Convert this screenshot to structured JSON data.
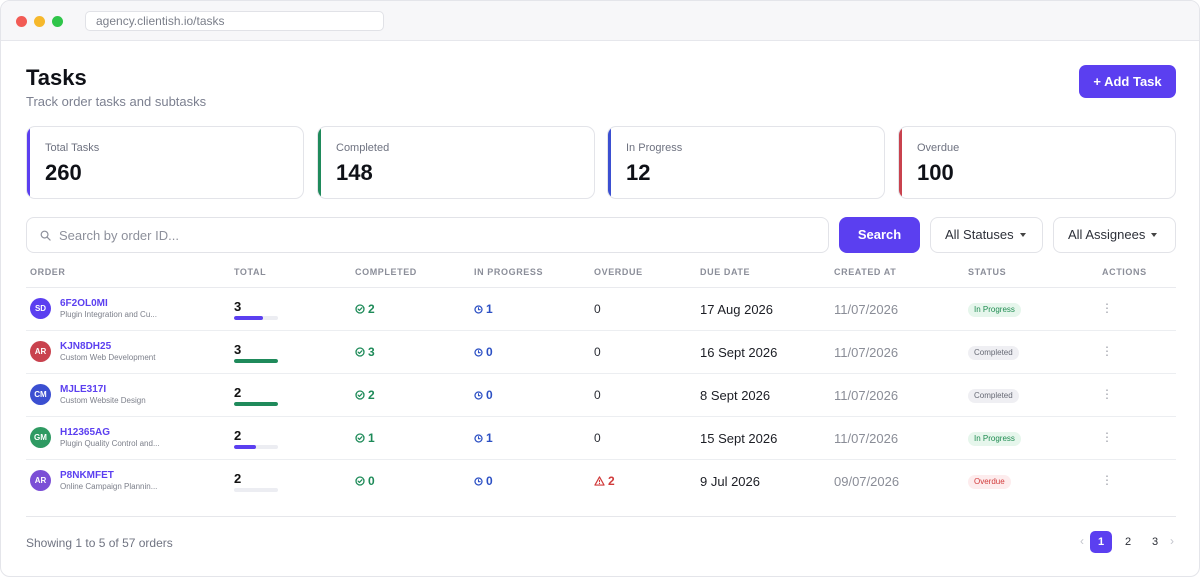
{
  "browser": {
    "url": "agency.clientish.io/tasks"
  },
  "header": {
    "title": "Tasks",
    "subtitle": "Track order tasks and subtasks",
    "add_label": "+ Add Task"
  },
  "stats": [
    {
      "label": "Total Tasks",
      "value": "260",
      "accent": "#5b3ff0"
    },
    {
      "label": "Completed",
      "value": "148",
      "accent": "#1f8a5b"
    },
    {
      "label": "In Progress",
      "value": "12",
      "accent": "#3b4fd1"
    },
    {
      "label": "Overdue",
      "value": "100",
      "accent": "#c9424e"
    }
  ],
  "filters": {
    "search_placeholder": "Search by order ID...",
    "search_label": "Search",
    "status_label": "All Statuses",
    "assignee_label": "All Assignees"
  },
  "table": {
    "headers": [
      "ORDER",
      "TOTAL",
      "COMPLETED",
      "IN PROGRESS",
      "OVERDUE",
      "DUE DATE",
      "CREATED AT",
      "STATUS",
      "ACTIONS"
    ],
    "rows": [
      {
        "initials": "SD",
        "avatar_color": "#5b3ff0",
        "id": "6F2OL0MI",
        "desc": "Plugin Integration and Cu...",
        "total": "3",
        "progress": 0.67,
        "bar_color": "#5b3ff0",
        "completed": "2",
        "in_progress": "1",
        "overdue": "0",
        "overdue_warn": false,
        "due": "17 Aug 2026",
        "created": "11/07/2026",
        "status": "In Progress",
        "status_type": "progress"
      },
      {
        "initials": "AR",
        "avatar_color": "#c9424e",
        "id": "KJN8DH25",
        "desc": "Custom Web Development",
        "total": "3",
        "progress": 1.0,
        "bar_color": "#1f8a5b",
        "completed": "3",
        "in_progress": "0",
        "overdue": "0",
        "overdue_warn": false,
        "due": "16 Sept 2026",
        "created": "11/07/2026",
        "status": "Completed",
        "status_type": "completed"
      },
      {
        "initials": "CM",
        "avatar_color": "#3b4fd1",
        "id": "MJLE317I",
        "desc": "Custom Website Design",
        "total": "2",
        "progress": 1.0,
        "bar_color": "#1f8a5b",
        "completed": "2",
        "in_progress": "0",
        "overdue": "0",
        "overdue_warn": false,
        "due": "8 Sept 2026",
        "created": "11/07/2026",
        "status": "Completed",
        "status_type": "completed"
      },
      {
        "initials": "GM",
        "avatar_color": "#2e9a62",
        "id": "H12365AG",
        "desc": "Plugin Quality Control and...",
        "total": "2",
        "progress": 0.5,
        "bar_color": "#5b3ff0",
        "completed": "1",
        "in_progress": "1",
        "overdue": "0",
        "overdue_warn": false,
        "due": "15 Sept 2026",
        "created": "11/07/2026",
        "status": "In Progress",
        "status_type": "progress"
      },
      {
        "initials": "AR",
        "avatar_color": "#7b4fd6",
        "id": "P8NKMFET",
        "desc": "Online Campaign Plannin...",
        "total": "2",
        "progress": 0.0,
        "bar_color": "#5b3ff0",
        "completed": "0",
        "in_progress": "0",
        "overdue": "2",
        "overdue_warn": true,
        "due": "9 Jul 2026",
        "created": "09/07/2026",
        "status": "Overdue",
        "status_type": "overdue"
      }
    ]
  },
  "footer": {
    "showing": "Showing 1 to 5 of 57 orders",
    "pages": [
      "1",
      "2",
      "3"
    ],
    "current_page": "1"
  }
}
